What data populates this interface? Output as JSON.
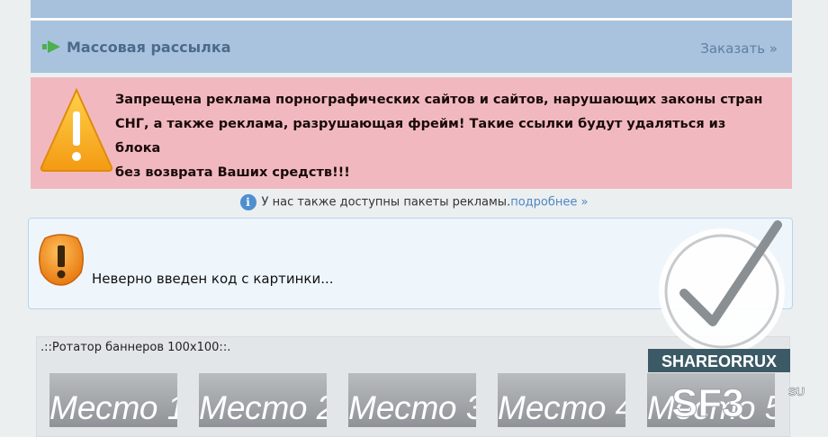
{
  "mass_mailing": {
    "title": "Массовая рассылка",
    "order_link": "Заказать »"
  },
  "warning": {
    "line1": "Запрещена реклама порнографических сайтов и сайтов, нарушающих законы стран",
    "line2": "СНГ, а также реклама, разрушающая фрейм! Такие ссылки будут удаляться из блока",
    "line3": "без возврата Ваших средств!!!"
  },
  "info": {
    "text": "У нас также доступны пакеты рекламы.",
    "link": "подробнее »"
  },
  "error": {
    "message": "Неверно введен код с картинки..."
  },
  "rotator": {
    "title": ".::Ротатор баннеров 100x100::.",
    "places": [
      "Место 1",
      "Место 2",
      "Место 3",
      "Место 4",
      "Место 5"
    ]
  },
  "watermark": {
    "ribbon_text": "SHAREORRUX",
    "brand": "SF3",
    "brand_suffix": "SU"
  },
  "colors": {
    "header_bg": "#a9c3de",
    "warning_bg": "#f1b9bf",
    "info_bg": "#eef6fc",
    "link": "#4e86c5"
  },
  "icons": {
    "mass_mailing": "green-arrow-icon",
    "warning": "warning-triangle-icon",
    "info": "info-circle-icon",
    "error": "error-exclamation-icon"
  }
}
